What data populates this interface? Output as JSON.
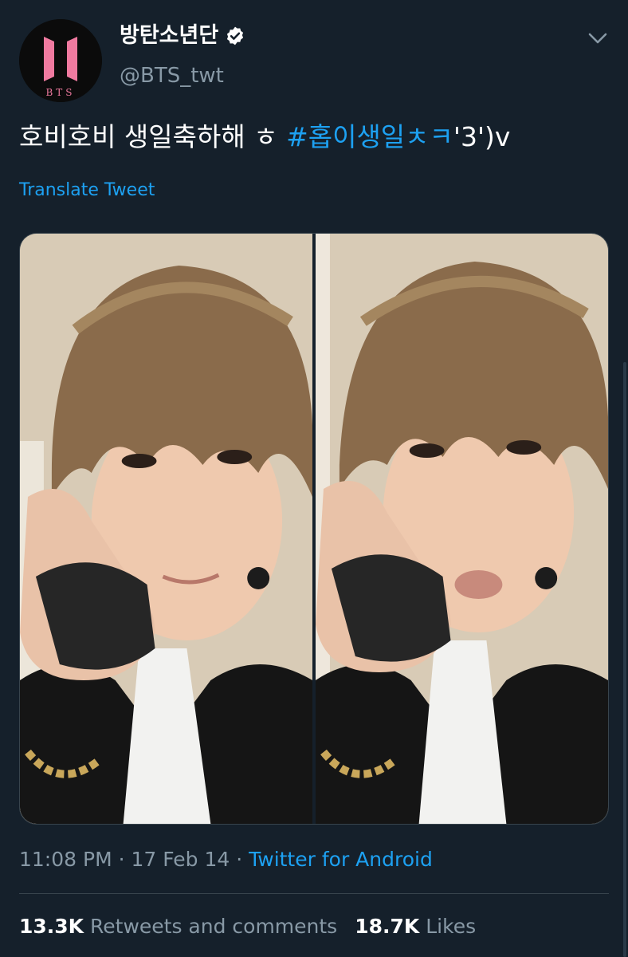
{
  "profile": {
    "display_name": "방탄소년단",
    "handle": "@BTS_twt",
    "avatar_text": "BTS",
    "verified": true
  },
  "tweet": {
    "text_plain": "호비호비 생일축하해 ㅎ ",
    "hashtag": "#홉이생일ㅊㅋ",
    "text_tail": "'3')v",
    "translate_label": "Translate Tweet",
    "media_count": 2
  },
  "meta": {
    "time": "11:08 PM",
    "separator": " · ",
    "date": "17 Feb 14",
    "source": "Twitter for Android"
  },
  "stats": {
    "retweets_count": "13.3K",
    "retweets_label": "Retweets and comments",
    "likes_count": "18.7K",
    "likes_label": "Likes"
  },
  "theme": {
    "background": "#15202b",
    "accent": "#1da1f2",
    "muted": "#8899a6",
    "logo_pink": "#f07aa0"
  },
  "icons": {
    "verified": "verified-badge-icon",
    "caret": "chevron-down-icon"
  }
}
